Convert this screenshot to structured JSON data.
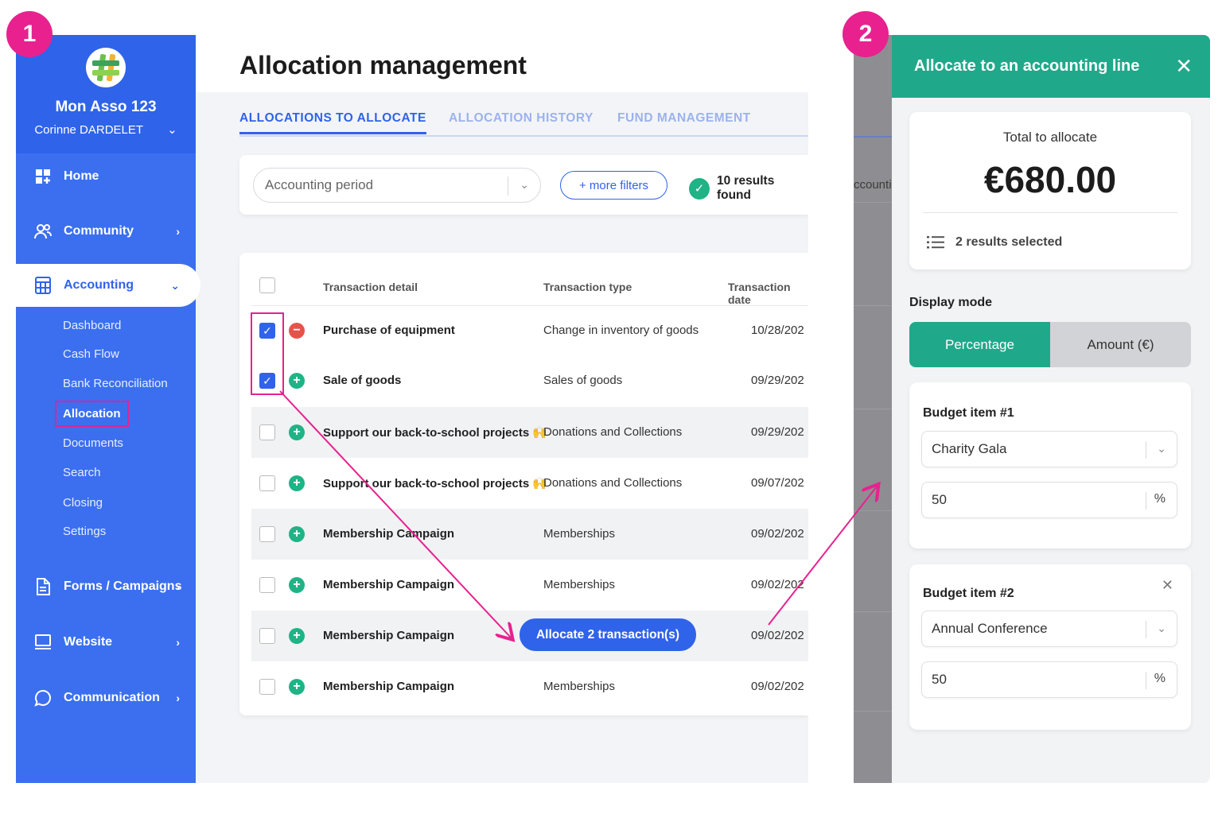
{
  "badges": {
    "step1": "1",
    "step2": "2"
  },
  "sidebar": {
    "org_name": "Mon Asso 123",
    "user_name": "Corinne DARDELET",
    "nav": [
      {
        "label": "Home",
        "icon": "home-grid-icon"
      },
      {
        "label": "Community",
        "icon": "people-icon"
      },
      {
        "label": "Accounting",
        "icon": "calculator-icon"
      },
      {
        "label": "Forms / Campaigns",
        "icon": "document-icon"
      },
      {
        "label": "Website",
        "icon": "monitor-icon"
      },
      {
        "label": "Communication",
        "icon": "chat-bubble-icon"
      }
    ],
    "accounting_sub": [
      "Dashboard",
      "Cash Flow",
      "Bank Reconciliation",
      "Allocation",
      "Documents",
      "Search",
      "Closing",
      "Settings"
    ]
  },
  "main": {
    "title": "Allocation management",
    "tabs": [
      "ALLOCATIONS TO ALLOCATE",
      "ALLOCATION HISTORY",
      "FUND MANAGEMENT"
    ],
    "filters": {
      "period_placeholder": "Accounting period",
      "more_filters": "+ more filters",
      "results": "10 results found"
    },
    "table": {
      "headers": [
        "Transaction detail",
        "Transaction type",
        "Transaction date"
      ],
      "rows": [
        {
          "detail": "Purchase of equipment",
          "type": "Change in inventory of goods",
          "date": "10/28/202",
          "checked": true,
          "sign": "minus"
        },
        {
          "detail": "Sale of goods",
          "type": "Sales of goods",
          "date": "09/29/202",
          "checked": true,
          "sign": "plus"
        },
        {
          "detail": "Support our back-to-school projects 🙌",
          "type": "Donations and Collections",
          "date": "09/29/202",
          "checked": false,
          "sign": "plus"
        },
        {
          "detail": "Support our back-to-school projects 🙌",
          "type": "Donations and Collections",
          "date": "09/07/202",
          "checked": false,
          "sign": "plus"
        },
        {
          "detail": "Membership Campaign",
          "type": "Memberships",
          "date": "09/02/202",
          "checked": false,
          "sign": "plus"
        },
        {
          "detail": "Membership Campaign",
          "type": "Memberships",
          "date": "09/02/202",
          "checked": false,
          "sign": "plus"
        },
        {
          "detail": "Membership Campaign",
          "type": "",
          "date": "09/02/202",
          "checked": false,
          "sign": "plus"
        },
        {
          "detail": "Membership Campaign",
          "type": "Memberships",
          "date": "09/02/202",
          "checked": false,
          "sign": "plus"
        }
      ]
    },
    "allocate_button": "Allocate 2 transaction(s)"
  },
  "panel": {
    "backdrop_text": "ccountin",
    "title": "Allocate to an accounting line",
    "total_label": "Total to allocate",
    "total_value": "€680.00",
    "selected": "2 results selected",
    "display_mode_label": "Display mode",
    "modes": [
      "Percentage",
      "Amount (€)"
    ],
    "active_mode": "Percentage",
    "budget_items": [
      {
        "title": "Budget item #1",
        "selection": "Charity Gala",
        "value": "50",
        "unit": "%"
      },
      {
        "title": "Budget item #2",
        "selection": "Annual Conference",
        "value": "50",
        "unit": "%"
      }
    ]
  },
  "colors": {
    "primary": "#2f63ea",
    "accent": "#20a88a",
    "highlight": "#e8218f",
    "minus": "#e5534b",
    "plus": "#1fb386"
  }
}
